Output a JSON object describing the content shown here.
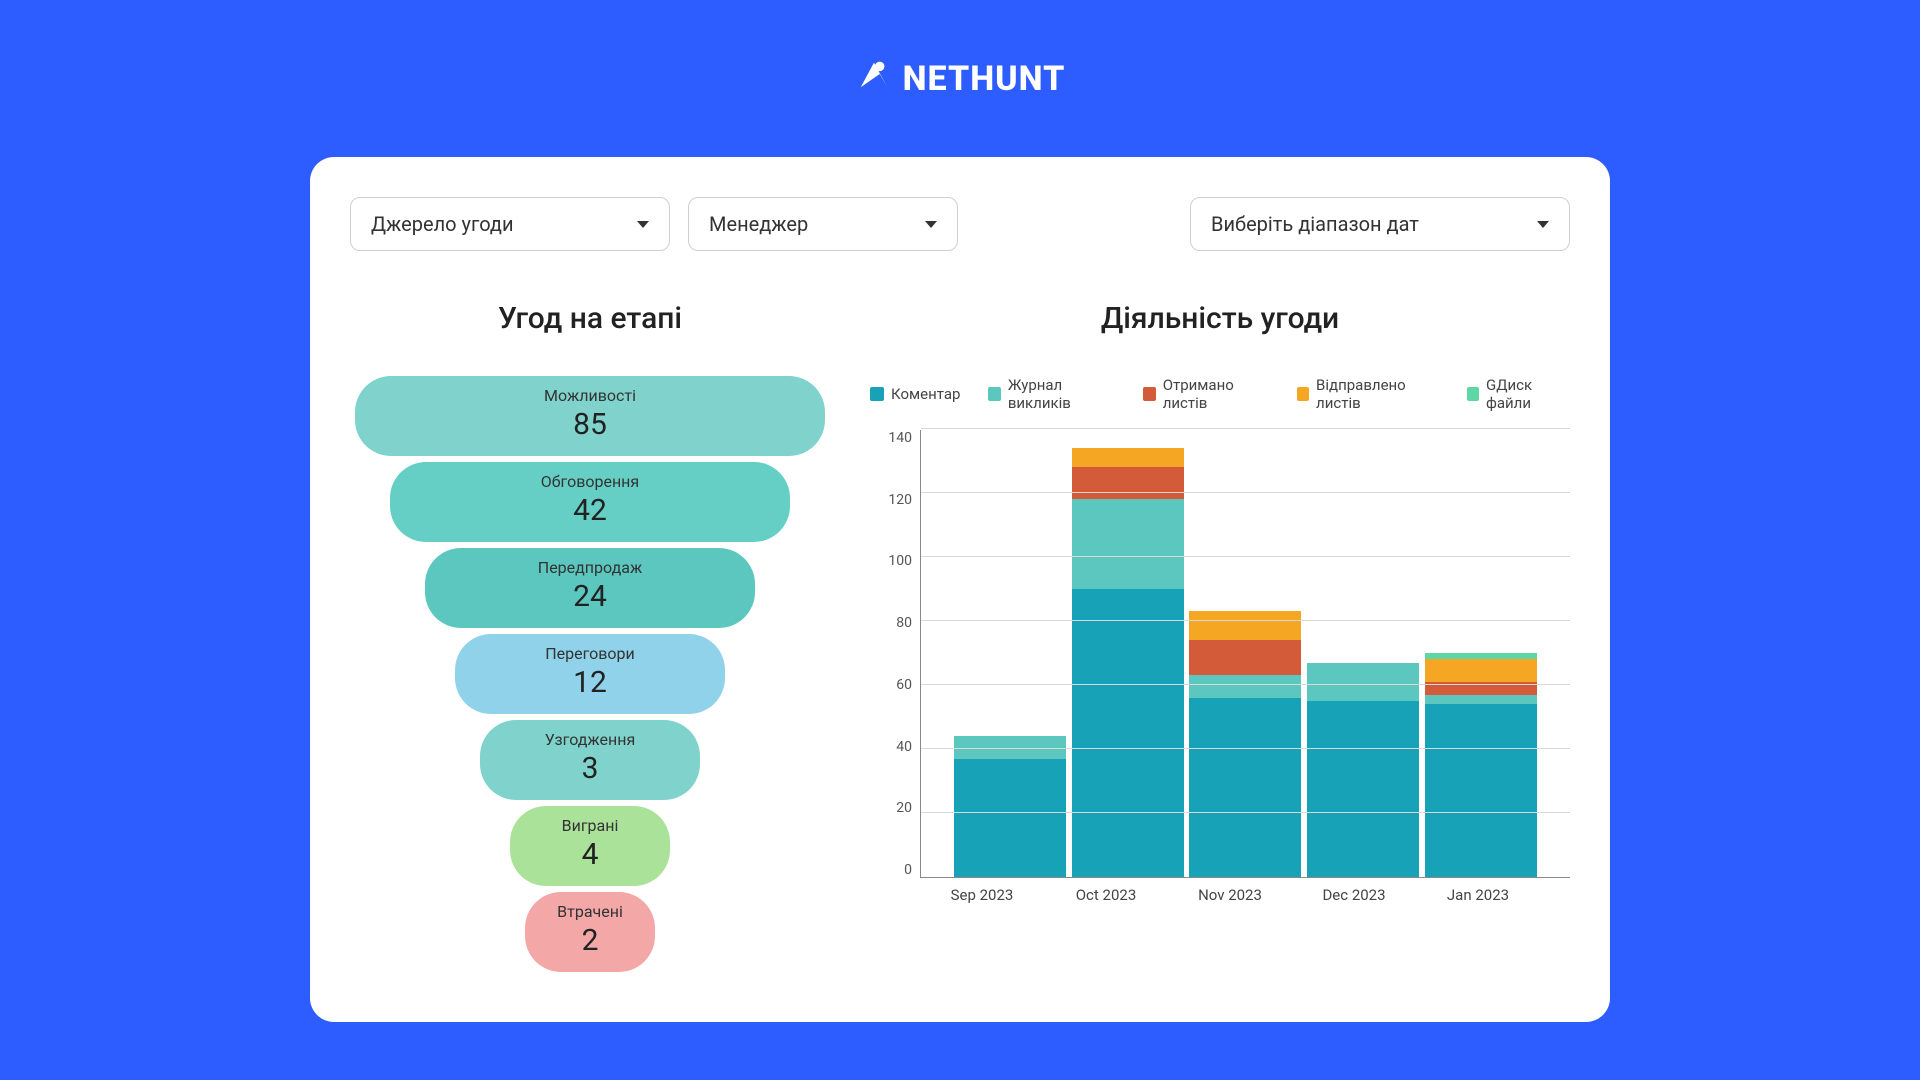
{
  "brand": "NETHUNT",
  "filters": {
    "source": "Джерело угоди",
    "manager": "Менеджер",
    "dates": "Виберіть діапазон дат"
  },
  "funnel": {
    "title": "Угод на етапі",
    "stages": [
      {
        "label": "Можливості",
        "value": 85
      },
      {
        "label": "Обговорення",
        "value": 42
      },
      {
        "label": "Передпродаж",
        "value": 24
      },
      {
        "label": "Переговори",
        "value": 12
      },
      {
        "label": "Узгодження",
        "value": 3
      },
      {
        "label": "Виграні",
        "value": 4
      },
      {
        "label": "Втрачені",
        "value": 2
      }
    ]
  },
  "activity": {
    "title": "Діяльність угоди",
    "legend": {
      "comment": "Коментар",
      "calls": "Журнал викликів",
      "received": "Отримано листів",
      "sent": "Відправлено листів",
      "gdisk": "GДиск файли"
    }
  },
  "chart_data": {
    "type": "bar",
    "stacked": true,
    "title": "Діяльність угоди",
    "xlabel": "",
    "ylabel": "",
    "ylim": [
      0,
      140
    ],
    "yticks": [
      0,
      20,
      40,
      60,
      80,
      100,
      120,
      140
    ],
    "categories": [
      "Sep 2023",
      "Oct 2023",
      "Nov 2023",
      "Dec 2023",
      "Jan 2023"
    ],
    "series": [
      {
        "name": "Коментар",
        "color": "#17a2b8",
        "values": [
          37,
          90,
          56,
          55,
          54
        ]
      },
      {
        "name": "Журнал викликів",
        "color": "#5bc7bf",
        "values": [
          7,
          28,
          7,
          12,
          3
        ]
      },
      {
        "name": "Отримано листів",
        "color": "#d35b3a",
        "values": [
          0,
          10,
          11,
          0,
          4
        ]
      },
      {
        "name": "Відправлено листів",
        "color": "#f5a623",
        "values": [
          0,
          6,
          9,
          0,
          7
        ]
      },
      {
        "name": "GДиск файли",
        "color": "#5fd6a6",
        "values": [
          0,
          0,
          0,
          0,
          2
        ]
      }
    ]
  }
}
